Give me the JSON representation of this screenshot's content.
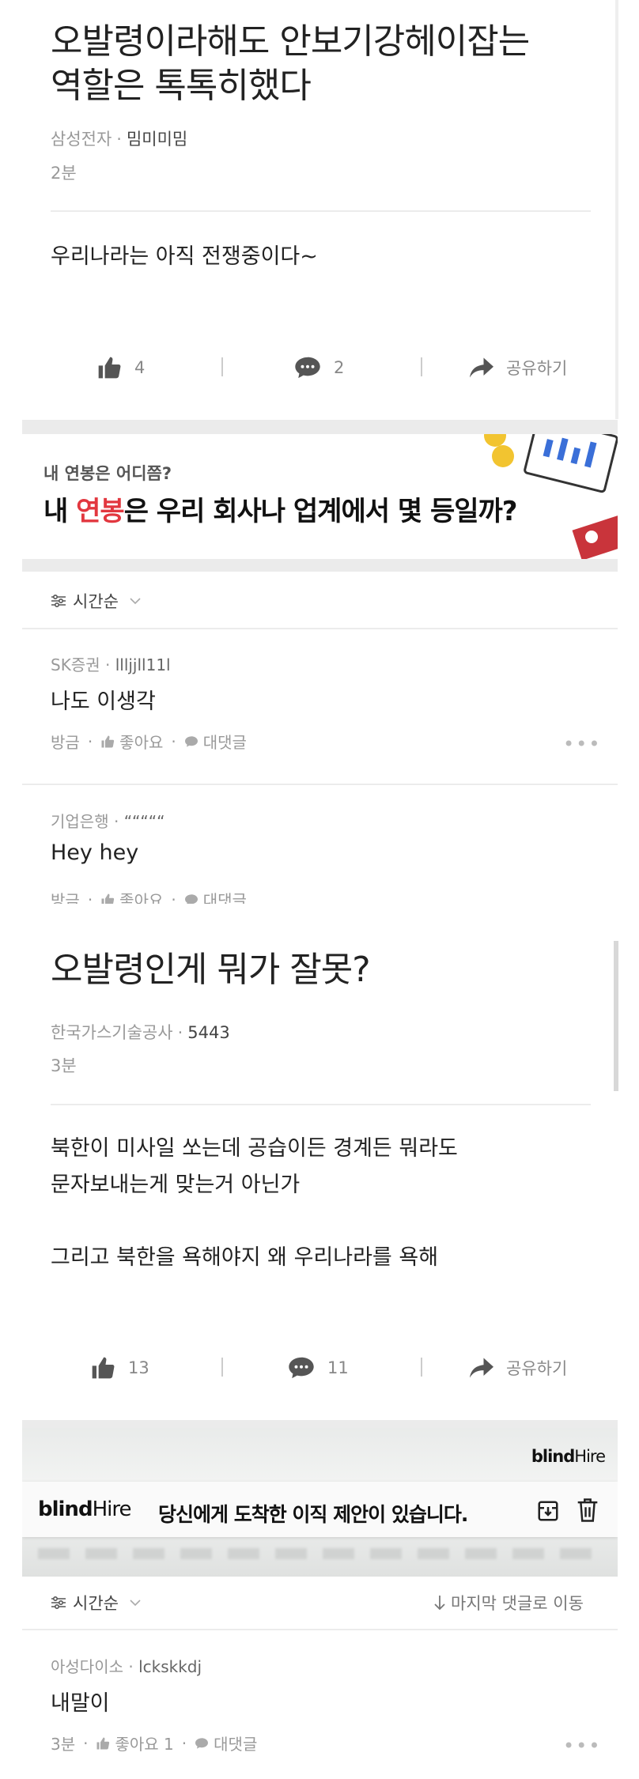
{
  "post1": {
    "title_line1": "오발령이라해도 안보기강헤이잡는",
    "title_line2": "역할은 톡톡히했다",
    "company": "삼성전자",
    "author": "밈미미밈",
    "time": "2분",
    "body": "우리나라는 아직 전쟁중이다~",
    "likes": "4",
    "comments": "2",
    "share_label": "공유하기"
  },
  "banner1": {
    "subtitle": "내 연봉은 어디쯤?",
    "headline_pre": "내 ",
    "headline_highlight": "연봉",
    "headline_post": "은 우리 회사나 업계에서 몇 등일까?",
    "highlight_color": "#e2373f"
  },
  "comments1": {
    "sort_label": "시간순",
    "items": [
      {
        "company": "SK증권",
        "author": "llljjll11l",
        "body": "나도 이생각",
        "time": "방금",
        "like_label": "좋아요",
        "reply_label": "대댓글"
      },
      {
        "company": "기업은행",
        "author": "“““““",
        "body": "Hey hey",
        "time": "방금",
        "like_label": "좋아요",
        "reply_label": "대댓글"
      }
    ]
  },
  "post2": {
    "title": "오발령인게 뭐가 잘못?",
    "company": "한국가스기술공사",
    "author": "5443",
    "time": "3분",
    "body": "북한이 미사일 쏘는데 공습이든 경계든 뭐라도\n문자보내는게 맞는거 아닌가\n\n그리고 북한을 욕해야지 왜 우리나라를 욕해",
    "likes": "13",
    "comments": "11",
    "share_label": "공유하기"
  },
  "banner2": {
    "brand_top": "blind",
    "brand_top_suffix": "Hire",
    "brand": "blind",
    "brand_suffix": "Hire",
    "message": "당신에게 도착한 이직 제안이 있습니다."
  },
  "comments2": {
    "sort_label": "시간순",
    "jump_label": "마지막 댓글로 이동",
    "items": [
      {
        "company": "아성다이소",
        "author": "lckskkdj",
        "body": "내말이",
        "time": "3분",
        "like_label": "좋아요 1",
        "reply_label": "대댓글"
      }
    ]
  },
  "icons": {
    "like": "thumbs-up-icon",
    "comment": "speech-bubble-icon",
    "share": "share-arrow-icon",
    "sort": "filter-sliders-icon",
    "chevron": "chevron-down-icon",
    "more": "more-dots-icon",
    "archive": "archive-box-icon",
    "trash": "trash-icon"
  }
}
